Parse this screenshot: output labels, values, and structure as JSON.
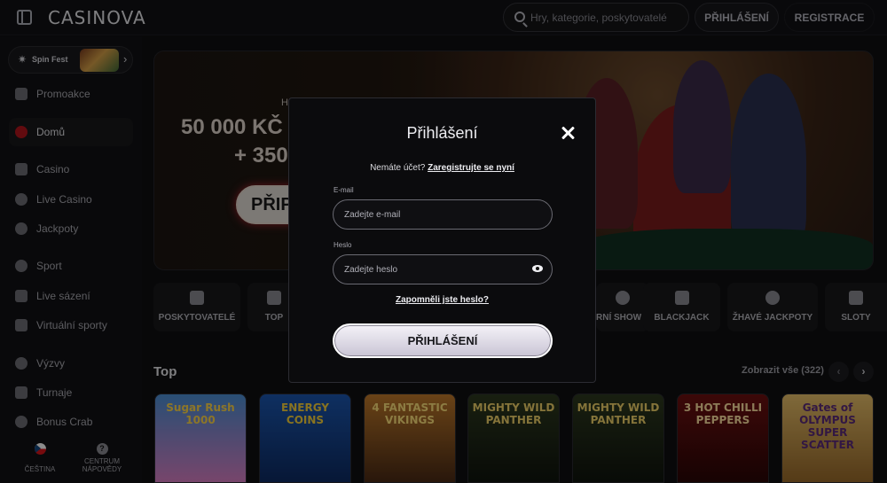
{
  "header": {
    "logo": "CASINOVA",
    "search_placeholder": "Hry, kategorie, poskytovatelé",
    "login_label": "PŘIHLÁŠENÍ",
    "register_label": "REGISTRACE"
  },
  "sidebar": {
    "promo_label": "Spin Fest",
    "items": [
      {
        "label": "Promoakce"
      },
      {
        "label": "Domů"
      },
      {
        "label": "Casino"
      },
      {
        "label": "Live Casino"
      },
      {
        "label": "Jackpoty"
      },
      {
        "label": "Sport"
      },
      {
        "label": "Live sázení"
      },
      {
        "label": "Virtuální sporty"
      },
      {
        "label": "Výzvy"
      },
      {
        "label": "Turnaje"
      },
      {
        "label": "Bonus Crab"
      }
    ],
    "footer": {
      "language_label": "ČEŠTINA",
      "help_label": "CENTRUM\nNÁPOVĚDY"
    }
  },
  "hero": {
    "small_text": "H",
    "line1": "50 000 KČ",
    "line2": "+ 350",
    "button_label": "PŘIP"
  },
  "categories": [
    {
      "label": "POSKYTOVATELÉ"
    },
    {
      "label": "TOP"
    },
    {
      "label": "RNÍ SHOW"
    },
    {
      "label": "BLACKJACK"
    },
    {
      "label": "ŽHAVÉ JACKPOTY"
    },
    {
      "label": "SLOTY"
    }
  ],
  "top_section": {
    "title": "Top",
    "view_all": "Zobrazit vše (322)",
    "games": [
      {
        "title": "Sugar Rush 1000",
        "color": "#5aa6e0"
      },
      {
        "title": "ENERGY COINS",
        "color": "#1b4f9c"
      },
      {
        "title": "4 FANTASTIC VIKINGS",
        "color": "#6b3a18"
      },
      {
        "title": "MIGHTY WILD PANTHER",
        "color": "#1f2a18"
      },
      {
        "title": "MIGHTY WILD PANTHER",
        "color": "#1f2a18"
      },
      {
        "title": "3 HOT CHILLI PEPPERS",
        "color": "#5a0d0d"
      },
      {
        "title": "Gates of OLYMPUS SUPER SCATTER",
        "color": "#c99a3a"
      }
    ]
  },
  "modal": {
    "title": "Přihlášení",
    "no_account_text": "Nemáte účet?",
    "register_link": "Zaregistrujte se nyní",
    "email_label": "E-mail",
    "email_placeholder": "Zadejte e-mail",
    "password_label": "Heslo",
    "password_placeholder": "Zadejte heslo",
    "forgot_password": "Zapomněli jste heslo?",
    "submit_label": "PŘIHLÁŠENÍ"
  }
}
